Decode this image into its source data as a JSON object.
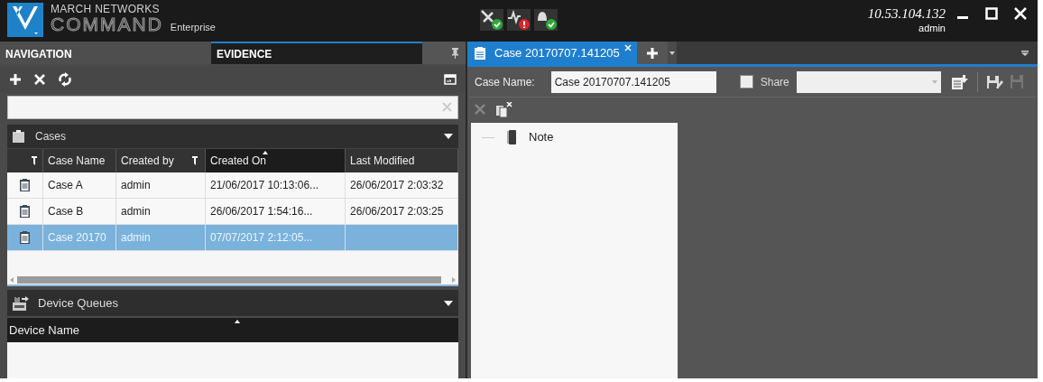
{
  "header": {
    "brand_top": "MARCH NETWORKS",
    "brand_main": "COMMAND",
    "edition": "Enterprise",
    "server": "10.53.104.132",
    "user": "admin",
    "status_icons": [
      {
        "kind": "tools",
        "alert": false
      },
      {
        "kind": "health",
        "alert": true
      },
      {
        "kind": "bell",
        "alert": false
      }
    ]
  },
  "left_tabs": [
    {
      "label": "NAVIGATION",
      "selected": false
    },
    {
      "label": "EVIDENCE",
      "selected": true
    }
  ],
  "cases": {
    "title": "Cases",
    "expanded": true,
    "columns": [
      {
        "label": "Case Name",
        "filter": false,
        "sorted": false
      },
      {
        "label": "Created by",
        "filter": true,
        "sorted": false
      },
      {
        "label": "Created On",
        "filter": false,
        "sorted": true
      },
      {
        "label": "Last Modified",
        "filter": false,
        "sorted": false
      }
    ],
    "rows": [
      {
        "name": "Case A",
        "created_by": "admin",
        "created_on": "21/06/2017 10:13:06...",
        "last_modified": "26/06/2017 2:03:32",
        "selected": false
      },
      {
        "name": "Case B",
        "created_by": "admin",
        "created_on": "26/06/2017 1:54:16...",
        "last_modified": "26/06/2017 2:03:25",
        "selected": false
      },
      {
        "name": "Case 20170",
        "created_by": "admin",
        "created_on": "07/07/2017 2:12:05...",
        "selected": true
      }
    ]
  },
  "device_queues": {
    "title": "Device Queues",
    "expanded": true,
    "columns": [
      {
        "label": "Device Name",
        "sorted": true
      }
    ]
  },
  "case_tabs": [
    {
      "label": "Case 20170707.141205",
      "selected": true
    }
  ],
  "case_form": {
    "name_label": "Case Name:",
    "name_value": "Case 20170707.141205",
    "share_label": "Share",
    "share_checked": false
  },
  "tree": [
    {
      "label": "Note",
      "kind": "note"
    }
  ]
}
